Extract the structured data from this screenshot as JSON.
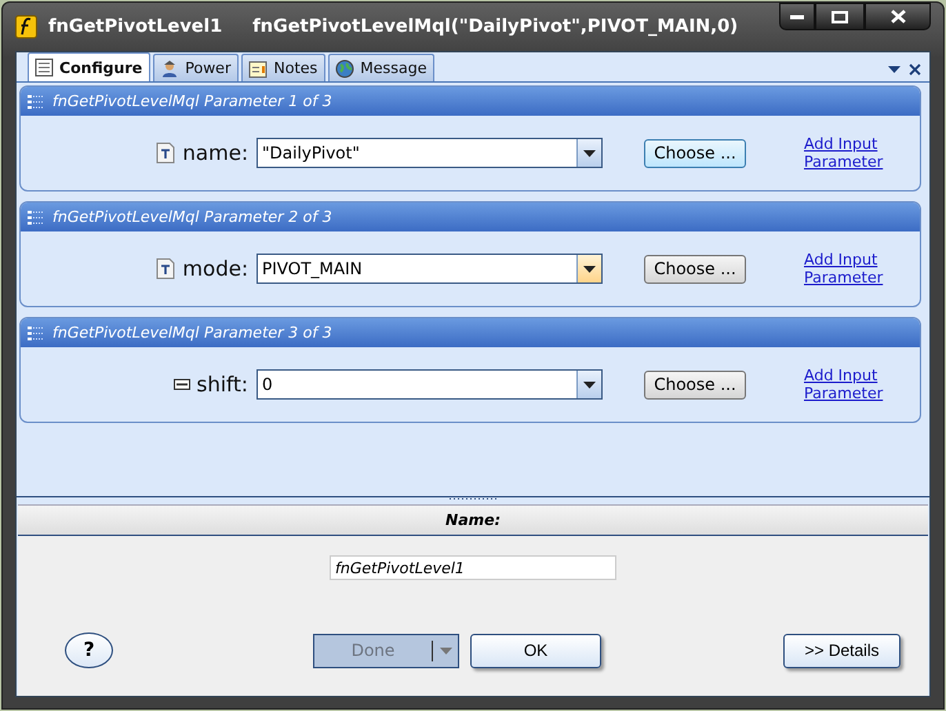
{
  "window": {
    "title": "fnGetPivotLevel1",
    "subtitle": "fnGetPivotLevelMql(\"DailyPivot\",PIVOT_MAIN,0)"
  },
  "tabs": [
    {
      "label": "Configure",
      "selected": true,
      "kind": "configure"
    },
    {
      "label": "Power",
      "selected": false,
      "kind": "power"
    },
    {
      "label": "Notes",
      "selected": false,
      "kind": "notes"
    },
    {
      "label": "Message",
      "selected": false,
      "kind": "message"
    }
  ],
  "parameters": [
    {
      "header": "fnGetPivotLevelMql Parameter 1 of 3",
      "label": "name:",
      "kind": "text",
      "value": "\"DailyPivot\"",
      "arrow_highlighted": false,
      "choose": {
        "label": "Choose ...",
        "highlighted": true
      },
      "link": "Add Input Parameter"
    },
    {
      "header": "fnGetPivotLevelMql Parameter 2 of 3",
      "label": "mode:",
      "kind": "text",
      "value": "PIVOT_MAIN",
      "arrow_highlighted": true,
      "choose": {
        "label": "Choose ...",
        "highlighted": false
      },
      "link": "Add Input Parameter"
    },
    {
      "header": "fnGetPivotLevelMql Parameter 3 of 3",
      "label": "shift:",
      "kind": "number",
      "value": "0",
      "arrow_highlighted": false,
      "choose": {
        "label": "Choose ...",
        "highlighted": false
      },
      "link": "Add Input Parameter"
    }
  ],
  "name_section": {
    "label": "Name:",
    "value": "fnGetPivotLevel1"
  },
  "buttons": {
    "help": "?",
    "done": {
      "label": "Done",
      "disabled": true
    },
    "ok": "OK",
    "details": ">> Details"
  }
}
